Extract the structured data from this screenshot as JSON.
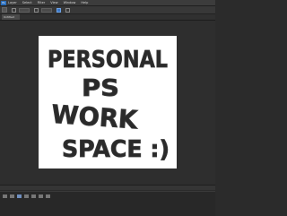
{
  "menubar": {
    "logo": "Ps",
    "items": [
      "Layer",
      "Select",
      "Filter",
      "View",
      "Window",
      "Help"
    ]
  },
  "document": {
    "tab_label": "Untitled"
  },
  "canvas": {
    "lines": [
      "PERSONAL",
      "PS",
      "WORK",
      "SPACE :)"
    ]
  },
  "statusbar": {
    "text": ""
  },
  "colors": {
    "accent": "#3a77c8",
    "workspace": "#2e2e2e",
    "panel": "#383838"
  }
}
